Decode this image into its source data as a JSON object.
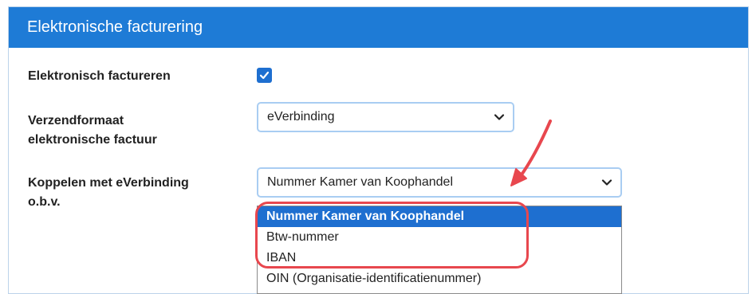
{
  "panel": {
    "title": "Elektronische facturering"
  },
  "fields": {
    "electronic_invoicing": {
      "label": "Elektronisch factureren",
      "checked": true
    },
    "send_format": {
      "label_line1": "Verzendformaat",
      "label_line2": "elektronische factuur",
      "value": "eVerbinding"
    },
    "link_by": {
      "label_line1": "Koppelen met eVerbinding",
      "label_line2": "o.b.v.",
      "value": "Nummer Kamer van Koophandel",
      "options": [
        "Nummer Kamer van Koophandel",
        "Btw-nummer",
        "IBAN",
        "OIN (Organisatie-identificatienummer)"
      ],
      "selected_index": 0
    }
  },
  "colors": {
    "header": "#1e7bd6",
    "accent": "#1e6fd0",
    "annotation": "#e8474e"
  }
}
